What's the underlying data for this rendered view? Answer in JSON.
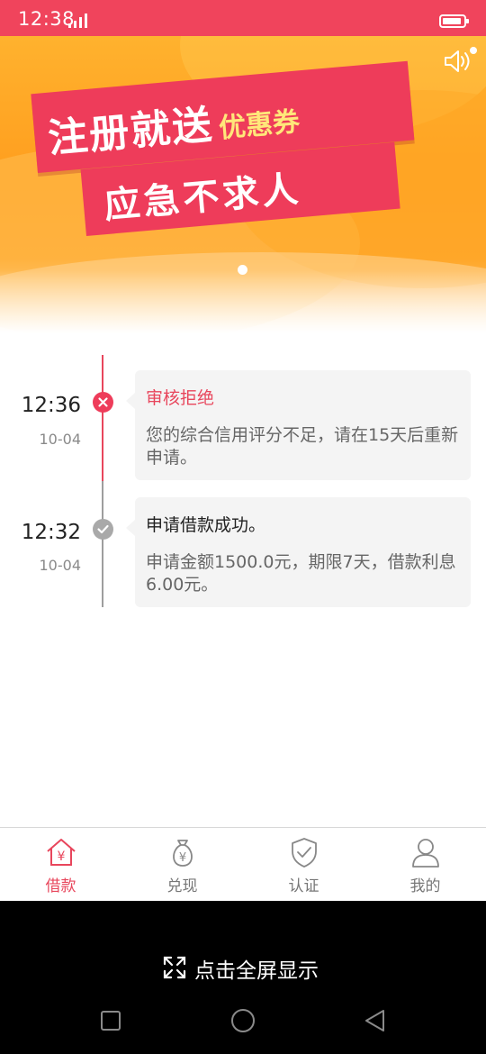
{
  "status_bar": {
    "time": "12:38",
    "color": "#f0445c"
  },
  "banner": {
    "headline_main": "注册就送",
    "headline_accent": "优惠券",
    "subline": "应急不求人",
    "speaker_icon": "speaker-icon",
    "page_indicator": "1 of 1"
  },
  "timeline": {
    "entries": [
      {
        "time": "12:36",
        "date": "10-04",
        "status_icon": "close-icon",
        "title": "审核拒绝",
        "body": "您的综合信用评分不足，请在15天后重新申请。",
        "color": "#e8465c"
      },
      {
        "time": "12:32",
        "date": "10-04",
        "status_icon": "check-icon",
        "title": "申请借款成功。",
        "body": "申请金额1500.0元，期限7天，借款利息6.00元。",
        "color": "#a9a9a9"
      }
    ]
  },
  "bottom_nav": {
    "items": [
      {
        "label": "借款",
        "icon": "home-yen-icon",
        "active": true
      },
      {
        "label": "兑现",
        "icon": "money-bag-icon",
        "active": false
      },
      {
        "label": "认证",
        "icon": "shield-check-icon",
        "active": false
      },
      {
        "label": "我的",
        "icon": "user-icon",
        "active": false
      }
    ],
    "active_color": "#e8465c"
  },
  "system": {
    "fullscreen_label": "点击全屏显示",
    "buttons": [
      "recent-apps-icon",
      "home-icon",
      "back-icon"
    ]
  }
}
